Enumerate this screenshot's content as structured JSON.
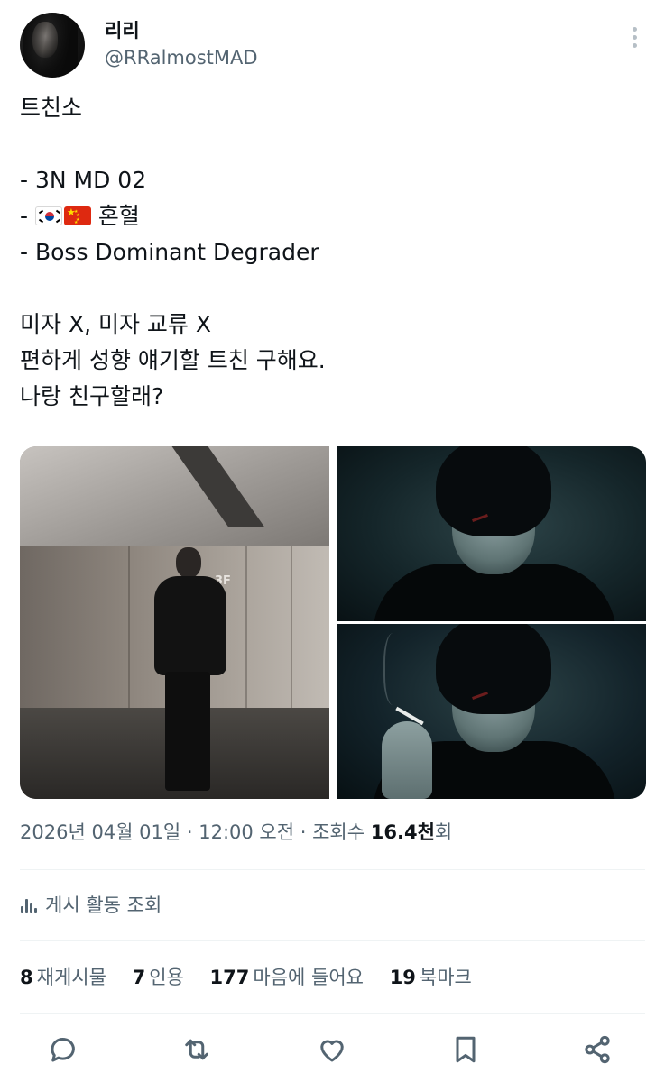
{
  "author": {
    "display_name": "리리",
    "handle": "@RRalmostMAD",
    "avatar_icon": "profile-photo"
  },
  "tweet": {
    "lines": [
      "트친소",
      "",
      "- 3N MD 02",
      "- ",
      "- Boss Dominant Degrader",
      "",
      "미자 X, 미자 교류 X",
      "편하게 성향 얘기할 트친 구해요.",
      "나랑 친구할래?"
    ],
    "mixed_blood_suffix": " 혼혈",
    "flags": [
      "south-korea-flag",
      "china-flag"
    ]
  },
  "media": {
    "sign_text": "3F",
    "photos": [
      "hallway-photo",
      "portrait-photo-top",
      "portrait-photo-smoking"
    ]
  },
  "meta": {
    "date": "2026년 04월 01일",
    "sep1": " · ",
    "time": "12:00 오전",
    "sep2": " · ",
    "views_label": "조회수 ",
    "views_value": "16.4천",
    "views_suffix": "회"
  },
  "activity": {
    "label": "게시 활동 조회",
    "icon": "bar-chart-icon"
  },
  "stats": [
    {
      "count": "8",
      "label": "재게시물"
    },
    {
      "count": "7",
      "label": "인용"
    },
    {
      "count": "177",
      "label": "마음에 들어요"
    },
    {
      "count": "19",
      "label": "북마크"
    }
  ],
  "actions": [
    "reply-icon",
    "repost-icon",
    "like-icon",
    "bookmark-icon",
    "share-icon"
  ],
  "colors": {
    "text_primary": "#0f1419",
    "text_secondary": "#536471",
    "divider": "#eff3f4"
  }
}
